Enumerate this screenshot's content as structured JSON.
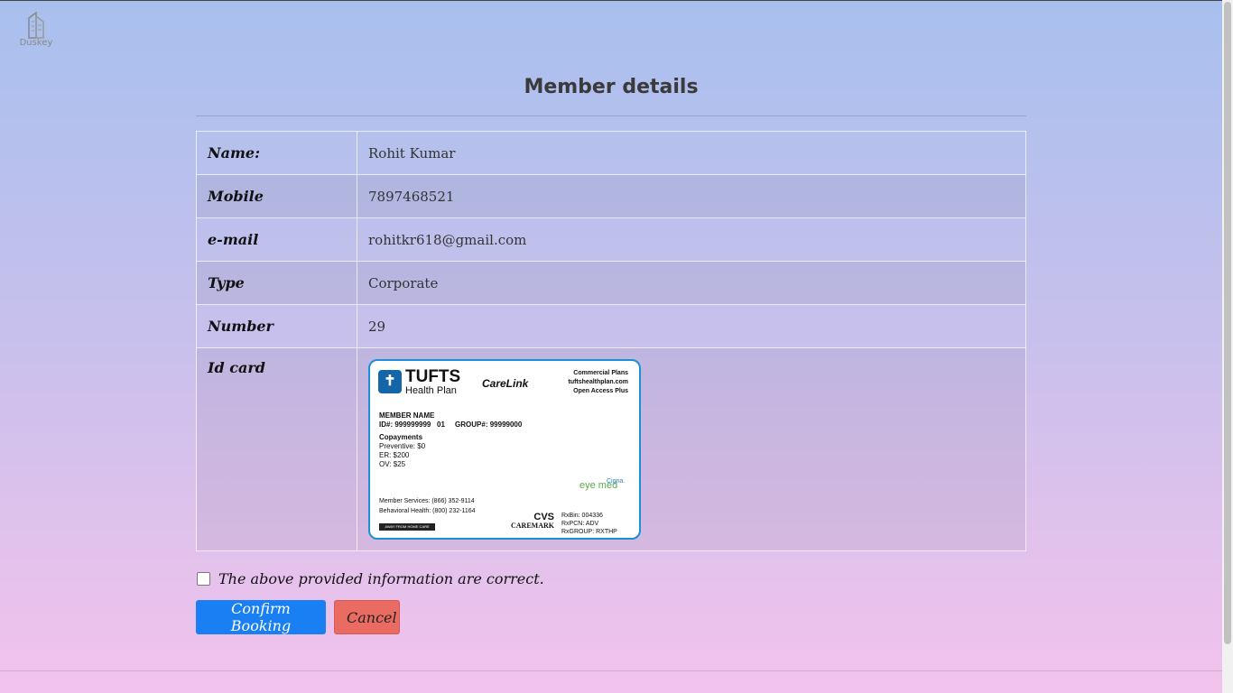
{
  "brand": {
    "name": "Duskey"
  },
  "page": {
    "title": "Member details"
  },
  "details": [
    {
      "label": "Name:",
      "value": "Rohit Kumar"
    },
    {
      "label": "Mobile",
      "value": "7897468521"
    },
    {
      "label": "e-mail",
      "value": "rohitkr618@gmail.com"
    },
    {
      "label": "Type",
      "value": "Corporate"
    },
    {
      "label": "Number",
      "value": "29"
    }
  ],
  "id_card": {
    "label": "Id card",
    "brand": "TUFTS",
    "brand_sub": "Health Plan",
    "carelink": "CareLink",
    "plans": [
      "Commercial Plans",
      "tuftshealthplan.com",
      "Open Access Plus"
    ],
    "member_name": "MEMBER NAME",
    "id_line": "ID#: 999999999   01     GROUP#: 99999000",
    "copay_title": "Copayments",
    "copays": [
      "Preventive: $0",
      "ER: $200",
      "OV: $25"
    ],
    "services": [
      "Member Services: (866) 352-9114",
      "Behavioral Health: (800) 232-1164"
    ],
    "away": "AWAY FROM HOME CARE",
    "eyemed": "eye med",
    "cigna": "Cigna.",
    "cvs": "CVS",
    "caremark": "CAREMARK",
    "rx": [
      "RxBin: 004336",
      "RxPCN: ADV",
      "RxGROUP: RXTHP"
    ]
  },
  "confirm": {
    "label": "The above provided information are correct.",
    "checked": false
  },
  "buttons": {
    "confirm": "Confirm Booking",
    "cancel": "Cancel"
  },
  "colors": {
    "confirm": "#1a7ff2",
    "cancel": "#ea6b62"
  }
}
